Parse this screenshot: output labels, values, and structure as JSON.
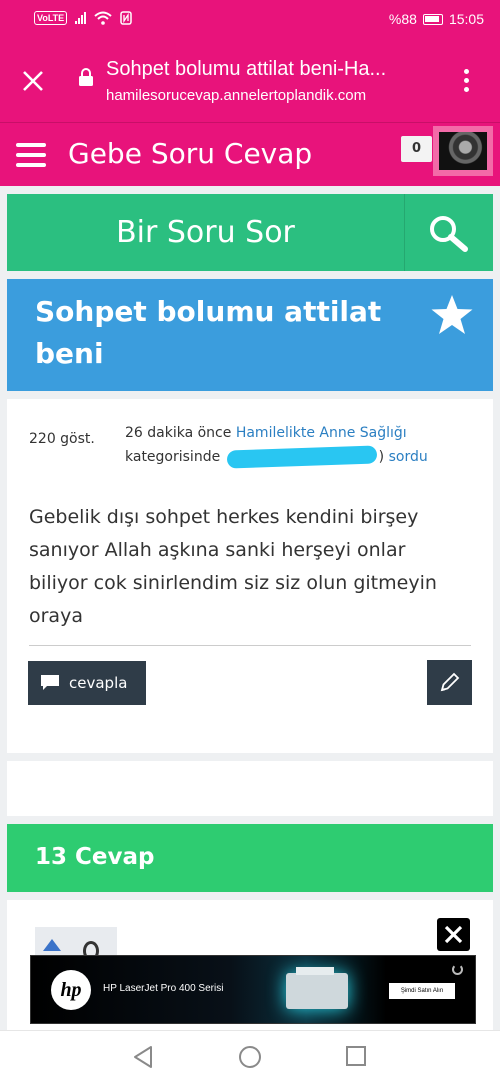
{
  "status_bar": {
    "network": "VoLTE",
    "battery": "%88",
    "time": "15:05"
  },
  "browser": {
    "page_title": "Sohpet bolumu attilat beni-Ha...",
    "url": "hamilesorucevap.annelertoplandik.com"
  },
  "site": {
    "name": "Gebe Soru Cevap",
    "notification_count": "0"
  },
  "ask_bar": {
    "ask_label": "Bir Soru Sor"
  },
  "question": {
    "title": "Sohpet bolumu attilat beni",
    "views": "220 göst.",
    "time_ago": "26 dakika önce",
    "category": "Hamilelikte Anne Sağlığı",
    "category_suffix": "kategorisinde",
    "asker_suffix": ")",
    "asked_verb": "sordu",
    "body": "Gebelik dışı sohpet herkes kendini birşey sanıyor Allah aşkına sanki herşeyi onlar biliyor cok sinirlendim siz siz olun gitmeyin oraya",
    "answer_button": "cevapla"
  },
  "answers": {
    "header": "13 Cevap"
  },
  "ad": {
    "brand": "hp",
    "product": "HP LaserJet Pro 400 Serisi",
    "cta": "Şimdi Satın Alın"
  },
  "colors": {
    "brand_pink": "#e8137b",
    "ask_green": "#2bbf80",
    "title_blue": "#3b9ddd",
    "answers_green": "#2ecc71",
    "button_dark": "#2f3c48",
    "link_blue": "#2b7fc2"
  },
  "icons": {
    "close": "close-icon",
    "lock": "lock-icon",
    "menu": "menu-icon",
    "search": "search-icon",
    "star": "star-icon",
    "comment": "comment-icon",
    "edit": "pencil-icon"
  }
}
